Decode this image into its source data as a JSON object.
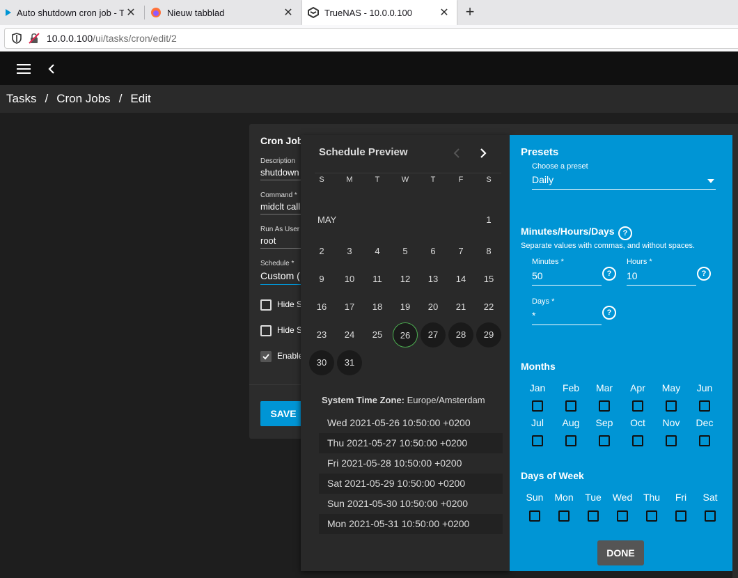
{
  "tabs": [
    {
      "title": "Auto shutdown cron job - TrueNAS",
      "icon": "truenas-icon"
    },
    {
      "title": "Nieuw tabblad",
      "icon": "firefox-icon"
    },
    {
      "title": "TrueNAS - 10.0.0.100",
      "icon": "truenas-icon",
      "active": true
    }
  ],
  "url": {
    "host": "10.0.0.100",
    "path": "/ui/tasks/cron/edit/2"
  },
  "breadcrumb": [
    "Tasks",
    "Cron Jobs",
    "Edit"
  ],
  "form": {
    "title": "Cron Jobs",
    "description_label": "Description",
    "description_value": "shutdown t",
    "command_label": "Command *",
    "command_value": "midclt call",
    "user_label": "Run As User *",
    "user_value": "root",
    "schedule_label": "Schedule *",
    "schedule_value": "Custom (",
    "hide_stdout_label": "Hide S",
    "hide_stderr_label": "Hide S",
    "enabled_label": "Enable",
    "save_label": "SAVE"
  },
  "preview": {
    "title": "Schedule Preview",
    "weekdays": [
      "S",
      "M",
      "T",
      "W",
      "T",
      "F",
      "S"
    ],
    "month": "MAY",
    "days": [
      "1",
      "2",
      "3",
      "4",
      "5",
      "6",
      "7",
      "8",
      "9",
      "10",
      "11",
      "12",
      "13",
      "14",
      "15",
      "16",
      "17",
      "18",
      "19",
      "20",
      "21",
      "22",
      "23",
      "24",
      "25",
      "26",
      "27",
      "28",
      "29",
      "30",
      "31"
    ],
    "run_days": [
      "26",
      "27",
      "28",
      "29",
      "30",
      "31"
    ],
    "today": "26",
    "timezone_label": "System Time Zone:",
    "timezone_value": "Europe/Amsterdam",
    "runs": [
      "Wed 2021-05-26 10:50:00 +0200",
      "Thu 2021-05-27 10:50:00 +0200",
      "Fri 2021-05-28 10:50:00 +0200",
      "Sat 2021-05-29 10:50:00 +0200",
      "Sun 2021-05-30 10:50:00 +0200",
      "Mon 2021-05-31 10:50:00 +0200"
    ]
  },
  "scheduler": {
    "presets_title": "Presets",
    "preset_label": "Choose a preset",
    "preset_value": "Daily",
    "mhd_title": "Minutes/Hours/Days",
    "mhd_hint": "Separate values with commas, and without spaces.",
    "minutes_label": "Minutes *",
    "minutes_value": "50",
    "hours_label": "Hours *",
    "hours_value": "10",
    "days_label": "Days *",
    "days_value": "*",
    "months_title": "Months",
    "months": [
      "Jan",
      "Feb",
      "Mar",
      "Apr",
      "May",
      "Jun",
      "Jul",
      "Aug",
      "Sep",
      "Oct",
      "Nov",
      "Dec"
    ],
    "dow_title": "Days of Week",
    "weekdays": [
      "Sun",
      "Mon",
      "Tue",
      "Wed",
      "Thu",
      "Fri",
      "Sat"
    ],
    "done_label": "DONE"
  },
  "colors": {
    "accent": "#0095d5",
    "today_ring": "#4caf50"
  }
}
